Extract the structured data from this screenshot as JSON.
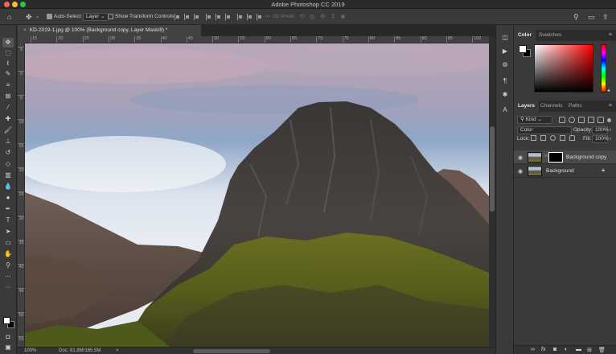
{
  "window": {
    "title": "Adobe Photoshop CC 2019"
  },
  "options_bar": {
    "home_icon": "home-icon",
    "move_tool_icon": "move-icon",
    "auto_select_label": "Auto-Select:",
    "auto_select_checked": true,
    "auto_select_target": "Layer",
    "show_transform_label": "Show Transform Controls",
    "show_transform_checked": false,
    "mode_3d_label": "3D Mode:",
    "search_icon": "search-icon",
    "workspace_icon": "workspace-icon",
    "share_icon": "share-icon"
  },
  "document": {
    "tab_label": "KD-2019-1.jpg @ 100% (Background copy, Layer Mask/8) *",
    "ruler_top": [
      "15",
      "20",
      "25",
      "30",
      "35",
      "40",
      "45",
      "50",
      "55",
      "60",
      "65",
      "70",
      "75",
      "80",
      "85",
      "90",
      "95",
      "100"
    ],
    "ruler_left": [
      "5",
      "0",
      "5",
      "10",
      "15",
      "20",
      "25",
      "30",
      "35",
      "40",
      "45",
      "50",
      "55"
    ]
  },
  "status": {
    "zoom": "100%",
    "doc_size": "Doc: 81.8M/165.5M",
    "arrow": ">"
  },
  "panels": {
    "color_tab": "Color",
    "swatches_tab": "Swatches",
    "layers_tab": "Layers",
    "channels_tab": "Channels",
    "paths_tab": "Paths",
    "filter_kind": "Kind",
    "blend_mode": "Color",
    "opacity_label": "Opacity:",
    "opacity_value": "100%",
    "lock_label": "Lock:",
    "fill_label": "Fill:",
    "fill_value": "100%",
    "foreground_color": "#ffffff",
    "background_color": "#000000"
  },
  "layers": [
    {
      "name": "Background copy",
      "selected": true,
      "has_mask": true,
      "locked": false
    },
    {
      "name": "Background",
      "selected": false,
      "has_mask": false,
      "locked": true
    }
  ],
  "colors": {
    "ui_background": "#323232",
    "panel": "#3a3a3a",
    "selected_layer": "#4a4a4a"
  }
}
